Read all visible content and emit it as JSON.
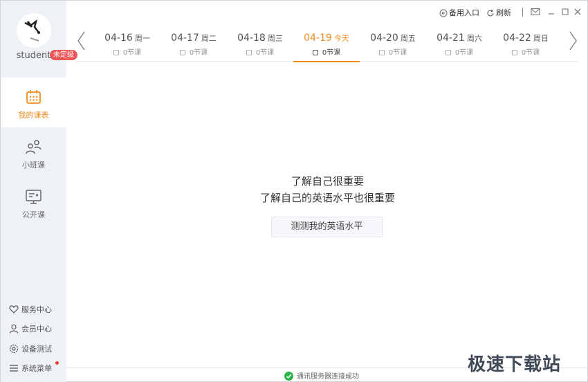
{
  "user": {
    "name": "student",
    "level_badge": "未定级"
  },
  "sidebar": {
    "items": [
      {
        "label": "我的课表",
        "icon": "calendar-icon",
        "active": true
      },
      {
        "label": "小班课",
        "icon": "group-icon",
        "active": false
      },
      {
        "label": "公开课",
        "icon": "presentation-icon",
        "active": false
      }
    ],
    "bottom": [
      {
        "label": "服务中心",
        "icon": "heart-icon"
      },
      {
        "label": "会员中心",
        "icon": "user-icon"
      },
      {
        "label": "设备测试",
        "icon": "settings-icon"
      },
      {
        "label": "系统菜单",
        "icon": "menu-icon"
      }
    ]
  },
  "titlebar": {
    "backup_entry": "备用入口",
    "refresh": "刷新"
  },
  "datebar": {
    "days": [
      {
        "date": "04-16",
        "weekday": "周一",
        "count": "0节课",
        "active": false
      },
      {
        "date": "04-17",
        "weekday": "周二",
        "count": "0节课",
        "active": false
      },
      {
        "date": "04-18",
        "weekday": "周三",
        "count": "0节课",
        "active": false
      },
      {
        "date": "04-19",
        "weekday": "今天",
        "count": "0节课",
        "active": true
      },
      {
        "date": "04-20",
        "weekday": "周五",
        "count": "0节课",
        "active": false
      },
      {
        "date": "04-21",
        "weekday": "周六",
        "count": "0节课",
        "active": false
      },
      {
        "date": "04-22",
        "weekday": "周日",
        "count": "0节课",
        "active": false
      }
    ]
  },
  "main": {
    "message_line1": "了解自己很重要",
    "message_line2": "了解自己的英语水平也很重要",
    "test_button": "测测我的英语水平"
  },
  "status": {
    "text": "通讯服务器连接成功"
  },
  "watermark": "极速下载站",
  "colors": {
    "accent": "#f08c1c",
    "sidebar_bg": "#eef1f5",
    "badge": "#ee5757",
    "success": "#2ab34a"
  }
}
